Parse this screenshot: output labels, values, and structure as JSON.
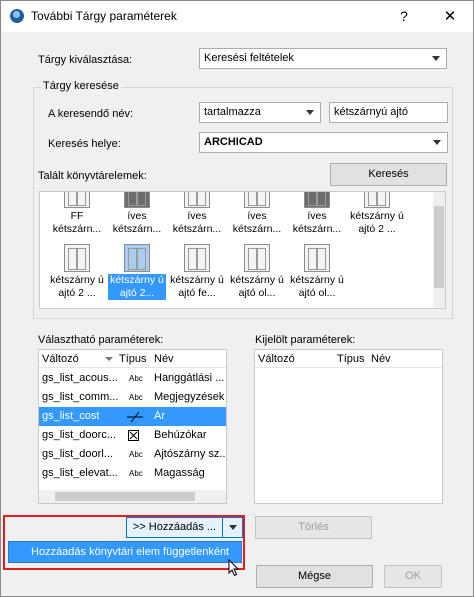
{
  "window": {
    "title": "További Tárgy paraméterek",
    "help": "?",
    "close": "✕"
  },
  "object_select": {
    "label": "Tárgy kiválasztása:",
    "value": "Keresési feltételek"
  },
  "search_group": {
    "title": "Tárgy keresése",
    "name_label": "A keresendő név:",
    "match_value": "tartalmazza",
    "name_value": "kétszárnyú ajtó",
    "location_label": "Keresés helye:",
    "location_value": "ARCHICAD",
    "found_label": "Talált könyvtárelemek:",
    "search_button": "Keresés",
    "items": [
      {
        "name": "FF kétszárn..."
      },
      {
        "name": "íves kétszárn..."
      },
      {
        "name": "íves kétszárn..."
      },
      {
        "name": "íves kétszárn..."
      },
      {
        "name": "íves kétszárn..."
      },
      {
        "name": "kétszárny ú ajtó 2 ..."
      },
      {
        "name": "kétszárny ú ajtó 2 ..."
      },
      {
        "name": "kétszárny ú ajtó 2..."
      },
      {
        "name": "kétszárny ú ajtó fe..."
      },
      {
        "name": "kétszárny ú ajtó ol..."
      },
      {
        "name": "kétszárny ú ajtó ol..."
      }
    ]
  },
  "available_params": {
    "title": "Választható paraméterek:",
    "columns": [
      "Változó",
      "Típus",
      "Név"
    ],
    "rows": [
      {
        "var": "gs_list_acous...",
        "type": "Abc",
        "name": "Hanggátlási ..."
      },
      {
        "var": "gs_list_comm...",
        "type": "Abc",
        "name": "Megjegyzések"
      },
      {
        "var": "gs_list_cost",
        "type": "cost-icon",
        "name": "Ár"
      },
      {
        "var": "gs_list_doorc...",
        "type": "box-icon",
        "name": "Behúzókar"
      },
      {
        "var": "gs_list_doorl...",
        "type": "Abc",
        "name": "Ajtószárny sz..."
      },
      {
        "var": "gs_list_elevat...",
        "type": "Abc",
        "name": "Magasság"
      }
    ]
  },
  "selected_params": {
    "title": "Kijelölt paraméterek:",
    "columns": [
      "Változó",
      "Típus",
      "Név"
    ]
  },
  "buttons": {
    "add": ">> Hozzáadás ...",
    "delete": "Törlés",
    "cancel": "Mégse",
    "ok": "OK"
  },
  "dropdown_menu": {
    "item": "Hozzáadás könyvtári elem függetlenként"
  },
  "colors": {
    "selection": "#3399ff",
    "highlight_box": "#e02020"
  }
}
